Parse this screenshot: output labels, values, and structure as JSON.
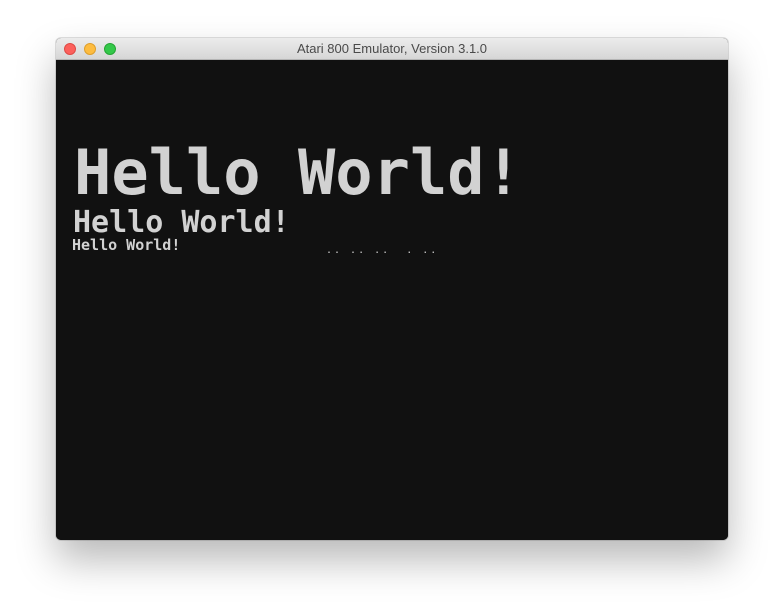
{
  "window": {
    "title": "Atari 800 Emulator, Version 3.1.0"
  },
  "screen": {
    "line_large": "Hello World!",
    "line_medium": "Hello World!",
    "line_small": "Hello World!",
    "trailing_dots": ".. .. ..  . .."
  },
  "colors": {
    "screen_bg": "#111111",
    "text": "#d2d2d2"
  }
}
